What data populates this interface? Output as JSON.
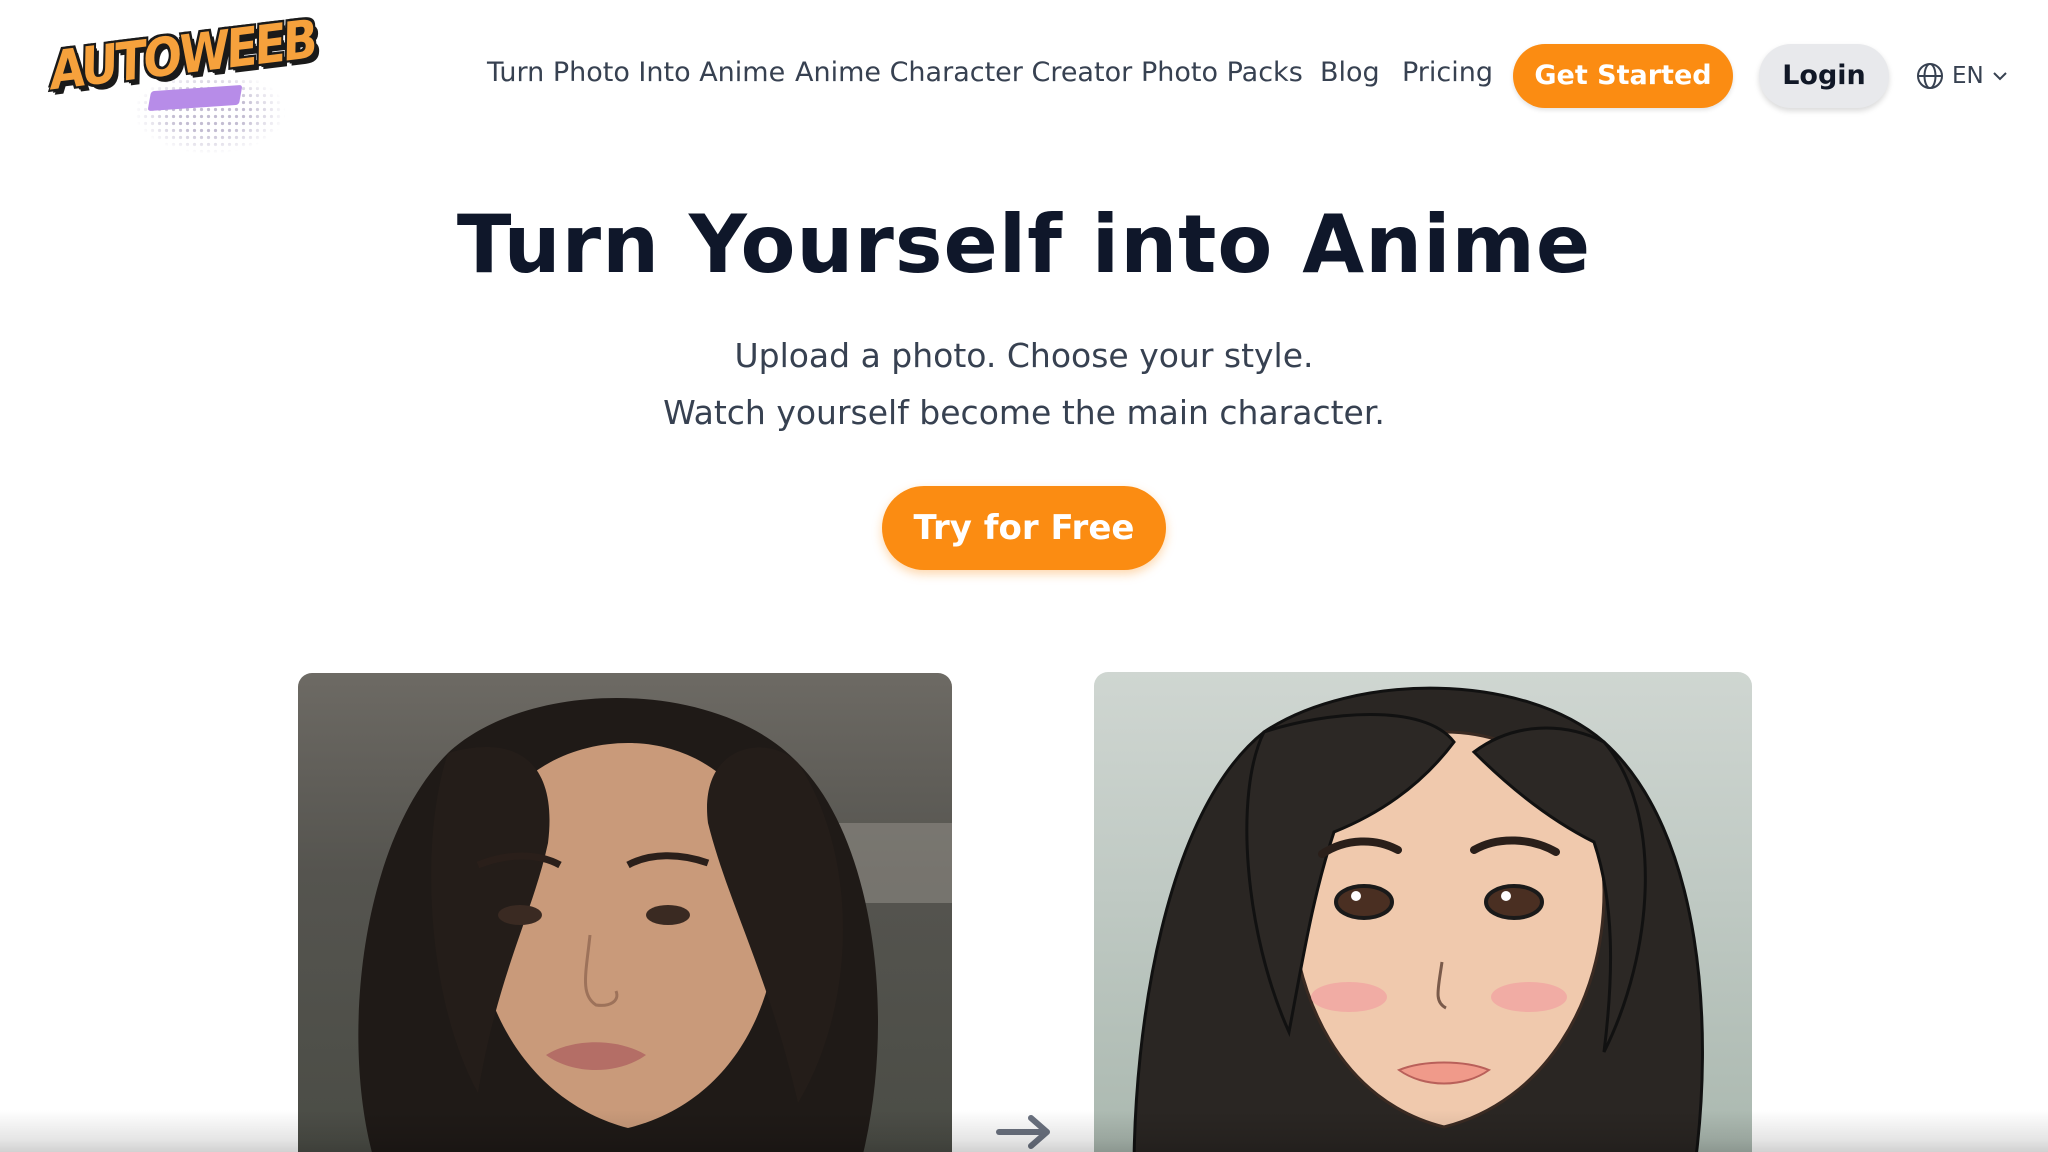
{
  "brand": {
    "logo_text": "AUTOWEEB"
  },
  "nav": {
    "links": [
      "Turn Photo Into Anime",
      "Anime Character Creator",
      "Photo Packs",
      "Blog",
      "Pricing"
    ],
    "get_started": "Get Started",
    "login": "Login",
    "language": "EN"
  },
  "hero": {
    "title": "Turn Yourself into Anime",
    "subtitle_line1": "Upload a photo. Choose your style.",
    "subtitle_line2": "Watch yourself become the main character.",
    "cta": "Try for Free"
  },
  "colors": {
    "accent": "#fb8c12",
    "title": "#0f172a",
    "text": "#374151",
    "login_bg": "#e8e9ec"
  },
  "icons": [
    "globe-icon",
    "chevron-down-icon",
    "arrow-right-icon"
  ]
}
